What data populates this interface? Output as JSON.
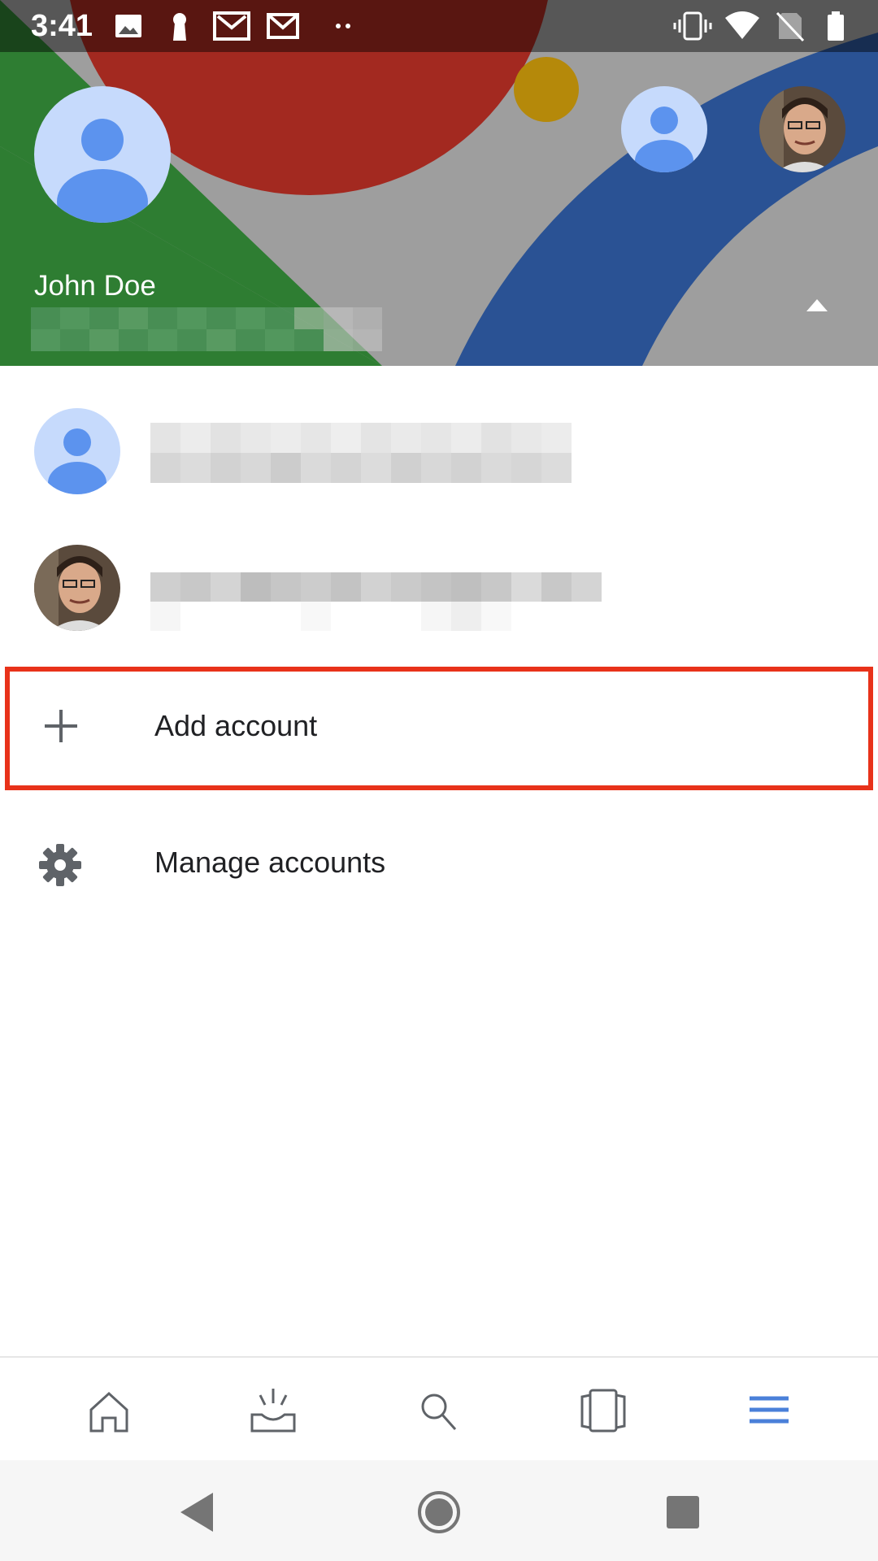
{
  "status_bar": {
    "time": "3:41",
    "left_icons": [
      "image-icon",
      "keyhole-icon",
      "gmail-stack-icon",
      "gmail-icon",
      "more-dots-icon"
    ],
    "right_icons": [
      "vibrate-icon",
      "wifi-icon",
      "no-sim-icon",
      "battery-icon"
    ]
  },
  "header": {
    "account_name": "John Doe",
    "colors": {
      "green": "#2e7d32",
      "red": "#a32920",
      "blue": "#2a5294",
      "gray": "#9e9e9e",
      "yellow": "#b5890a"
    }
  },
  "accounts": [
    {
      "avatar": "generic-avatar"
    },
    {
      "avatar": "photo-avatar"
    }
  ],
  "actions": {
    "add_account": "Add account",
    "manage_accounts": "Manage accounts"
  },
  "bottom_nav": {
    "items": [
      "home-icon",
      "inbox-icon",
      "search-icon",
      "cards-icon",
      "menu-icon"
    ],
    "active": "menu-icon",
    "active_color": "#4a80d9"
  },
  "system_nav": [
    "back-icon",
    "home-button-icon",
    "recents-icon"
  ],
  "highlight_color": "#e8321a"
}
